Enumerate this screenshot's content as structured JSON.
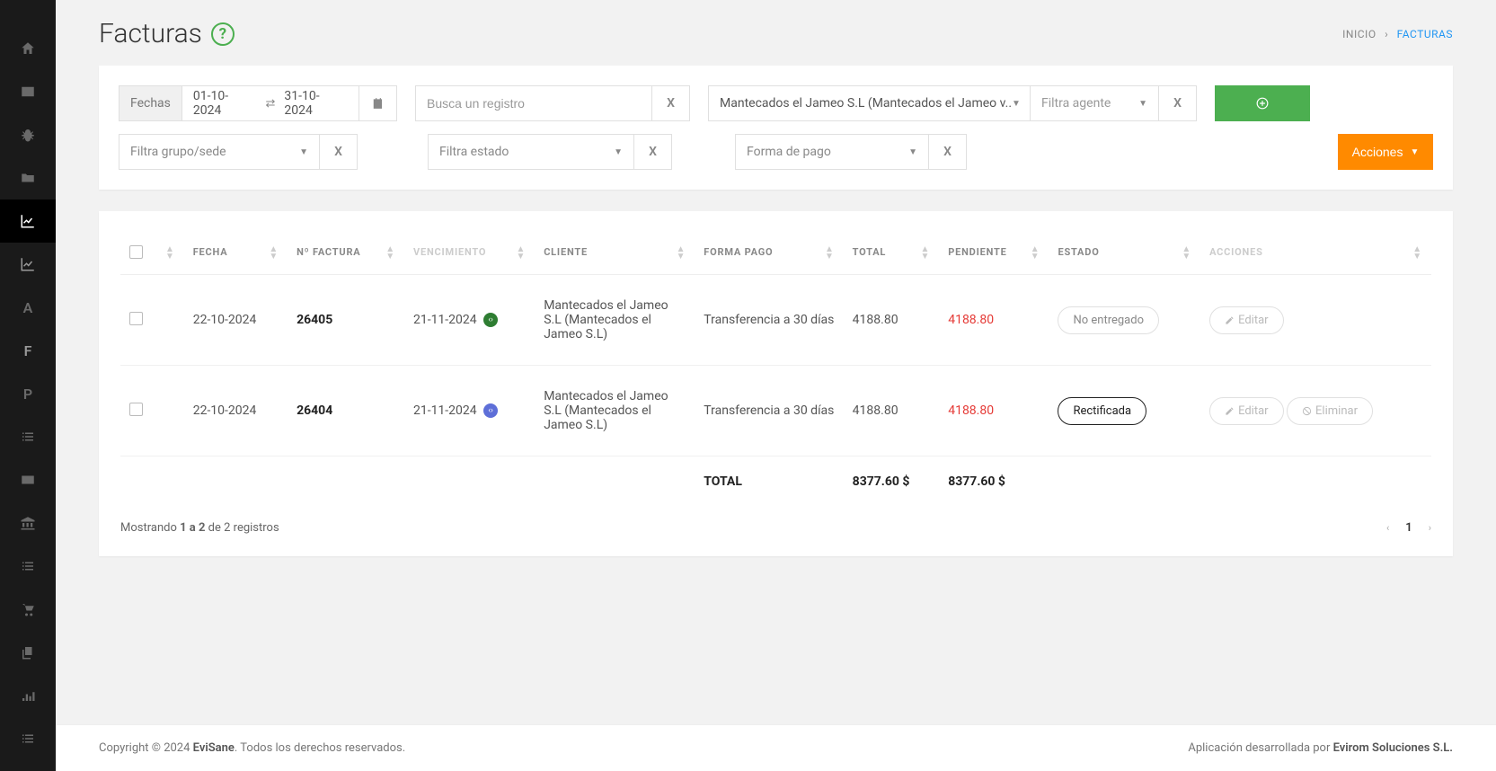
{
  "page": {
    "title": "Facturas",
    "breadcrumb_home": "INICIO",
    "breadcrumb_current": "FACTURAS"
  },
  "filters": {
    "dates_label": "Fechas",
    "date_from": "01-10-2024",
    "date_to": "31-10-2024",
    "search_placeholder": "Busca un registro",
    "client_value": "Mantecados el Jameo S.L (Mantecados el Jameo v..",
    "agent_placeholder": "Filtra agente",
    "group_placeholder": "Filtra grupo/sede",
    "estado_placeholder": "Filtra estado",
    "pago_placeholder": "Forma de pago",
    "clear": "X"
  },
  "buttons": {
    "acciones": "Acciones"
  },
  "table": {
    "headers": {
      "fecha": "FECHA",
      "num_factura": "Nº FACTURA",
      "vencimiento": "VENCIMIENTO",
      "cliente": "CLIENTE",
      "forma_pago": "FORMA PAGO",
      "total": "TOTAL",
      "pendiente": "PENDIENTE",
      "estado": "ESTADO",
      "acciones": "ACCIONES"
    },
    "rows": [
      {
        "fecha": "22-10-2024",
        "num": "26405",
        "vencimiento": "21-11-2024",
        "badge": "green",
        "cliente": "Mantecados el Jameo S.L (Mantecados el Jameo S.L)",
        "forma_pago": "Transferencia a 30 días",
        "total": "4188.80",
        "pendiente": "4188.80",
        "estado_label": "No entregado",
        "estado_style": "grey",
        "action_edit": "Editar",
        "action_delete": null
      },
      {
        "fecha": "22-10-2024",
        "num": "26404",
        "vencimiento": "21-11-2024",
        "badge": "blue",
        "cliente": "Mantecados el Jameo S.L (Mantecados el Jameo S.L)",
        "forma_pago": "Transferencia a 30 días",
        "total": "4188.80",
        "pendiente": "4188.80",
        "estado_label": "Rectificada",
        "estado_style": "black",
        "action_edit": "Editar",
        "action_delete": "Eliminar"
      }
    ],
    "totals": {
      "label": "TOTAL",
      "total": "8377.60 $",
      "pendiente": "8377.60 $"
    }
  },
  "pagination": {
    "info_prefix": "Mostrando ",
    "info_range": "1 a 2",
    "info_suffix": " de 2 registros",
    "current": "1"
  },
  "footer": {
    "copyright_prefix": "Copyright © 2024 ",
    "brand": "EviSane",
    "copyright_suffix": ". Todos los derechos reservados.",
    "right_prefix": "Aplicación desarrollada por ",
    "right_brand": "Evirom Soluciones S.L."
  }
}
